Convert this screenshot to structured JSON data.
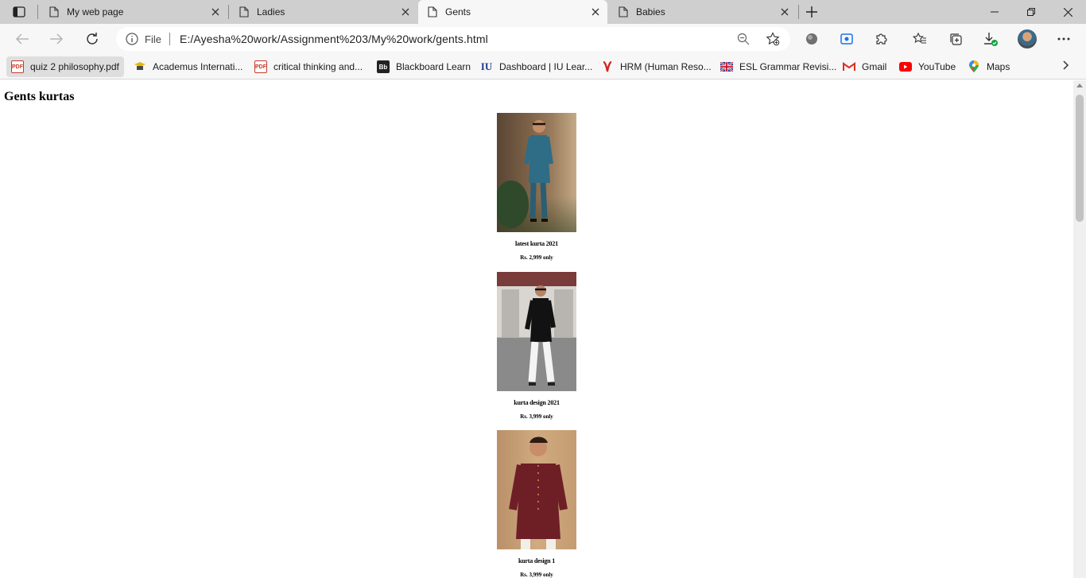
{
  "browser": {
    "tabs": [
      {
        "title": "My web page",
        "active": false
      },
      {
        "title": "Ladies",
        "active": false
      },
      {
        "title": "Gents",
        "active": true
      },
      {
        "title": "Babies",
        "active": false
      }
    ],
    "address": {
      "scheme_label": "File",
      "url": "E:/Ayesha%20work/Assignment%203/My%20work/gents.html"
    },
    "bookmarks": [
      {
        "label": "quiz 2 philosophy.pdf",
        "icon": "pdf-icon"
      },
      {
        "label": "Academus Internati...",
        "icon": "academus-icon"
      },
      {
        "label": "critical thinking and...",
        "icon": "pdf-icon"
      },
      {
        "label": "Blackboard Learn",
        "icon": "blackboard-icon"
      },
      {
        "label": "Dashboard | IU Lear...",
        "icon": "iu-icon"
      },
      {
        "label": "HRM (Human Reso...",
        "icon": "hrm-icon"
      },
      {
        "label": "ESL Grammar Revisi...",
        "icon": "uk-flag-icon"
      },
      {
        "label": "Gmail",
        "icon": "gmail-icon"
      },
      {
        "label": "YouTube",
        "icon": "youtube-icon"
      },
      {
        "label": "Maps",
        "icon": "maps-icon"
      }
    ]
  },
  "page": {
    "heading": "Gents kurtas",
    "products": [
      {
        "name": "latest kurta 2021",
        "price": "Rs. 2,999 only"
      },
      {
        "name": "kurta design 2021",
        "price": "Rs. 3,999 only"
      },
      {
        "name": "kurta design 1",
        "price": "Rs. 3,999 only"
      }
    ]
  },
  "colors": {
    "tabstrip_bg": "#cfcfcf",
    "toolbar_bg": "#f7f7f7",
    "youtube_red": "#ff0000",
    "gmail_red": "#d93025"
  }
}
